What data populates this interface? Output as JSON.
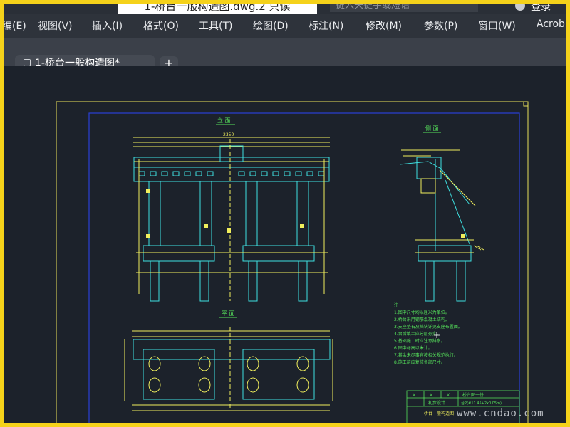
{
  "titlebar": {
    "doc_title": "1-桥台一般构造图.dwg.2 只读",
    "search_placeholder": "键入关键字或短语",
    "login_label": "登录"
  },
  "menu": {
    "items": [
      "编(E)",
      "视图(V)",
      "插入(I)",
      "格式(O)",
      "工具(T)",
      "绘图(D)",
      "标注(N)",
      "修改(M)",
      "参数(P)",
      "窗口(W)",
      "Acrob"
    ]
  },
  "tabs": {
    "active_tab": "1-桥台一般构造图*",
    "add_label": "+"
  },
  "drawing": {
    "elevation_title": "立 面",
    "side_title": "侧 面",
    "plan_title": "平 面",
    "dim_total": "2350",
    "notes_heading": "注",
    "notes_lines": [
      "1.图中尺寸均以厘米为单位。",
      "2.桥台采用钢筋混凝土结构。",
      "3.支座垫石及挡块详见支座布置图。",
      "4.台后填土应分层夯实。",
      "5.基础施工时应注意排水。",
      "6.图中标高以米计。",
      "7.其余未尽事宜按相关规范执行。",
      "8.施工前应复核各部尺寸。"
    ],
    "table_row1": [
      "X",
      "X",
      "X",
      "桥台图一份"
    ],
    "table_row2": [
      "初步设计",
      "台2(#11.45+2x0.05m)"
    ],
    "table_caption": "桥台一般构造图"
  },
  "watermark": "www.cndao.com"
}
